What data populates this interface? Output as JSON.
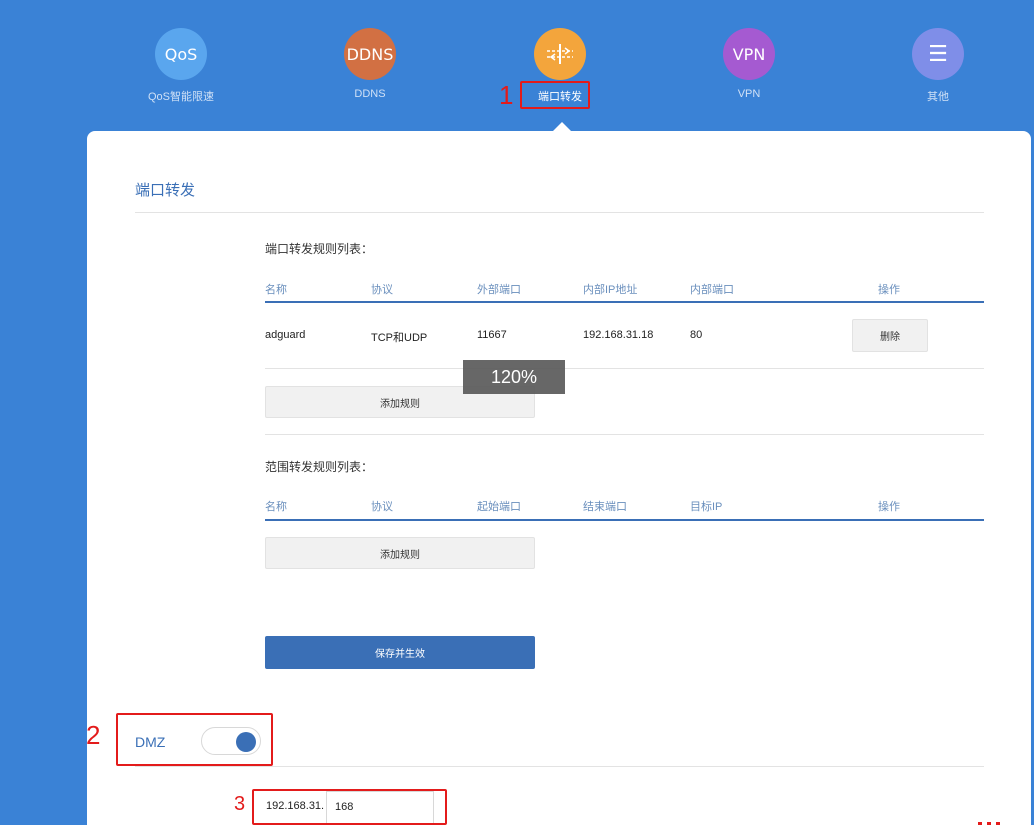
{
  "nav": {
    "items": [
      {
        "icon_text": "QoS",
        "label": "QoS智能限速",
        "color": "#5aa6ee"
      },
      {
        "icon_text": "DDNS",
        "label": "DDNS",
        "color": "#d27043"
      },
      {
        "icon_text": "",
        "label": "端口转发",
        "color": "#f3a53c"
      },
      {
        "icon_text": "VPN",
        "label": "VPN",
        "color": "#a55ad1"
      },
      {
        "icon_text": "☰",
        "label": "其他",
        "color": "#7f8ee8"
      }
    ]
  },
  "section_title": "端口转发",
  "port_forward": {
    "title": "端口转发规则列表：",
    "headers": [
      "名称",
      "协议",
      "外部端口",
      "内部IP地址",
      "内部端口",
      "操作"
    ],
    "rows": [
      {
        "name": "adguard",
        "protocol": "TCP和UDP",
        "ext_port": "11667",
        "int_ip": "192.168.31.18",
        "int_port": "80",
        "action": "删除"
      }
    ],
    "add_button": "添加规则"
  },
  "range_forward": {
    "title": "范围转发规则列表：",
    "headers": [
      "名称",
      "协议",
      "起始端口",
      "结束端口",
      "目标IP",
      "操作"
    ],
    "add_button": "添加规则"
  },
  "save_button": "保存并生效",
  "zoom_overlay": "120%",
  "dmz": {
    "label": "DMZ",
    "enabled": true,
    "ip_prefix": "192.168.31.",
    "ip_last": "168"
  },
  "annotations": [
    "1",
    "2",
    "3"
  ],
  "colors": {
    "background": "#3a82d6",
    "accent": "#3a6fb6",
    "annotation": "#e31b1b"
  }
}
